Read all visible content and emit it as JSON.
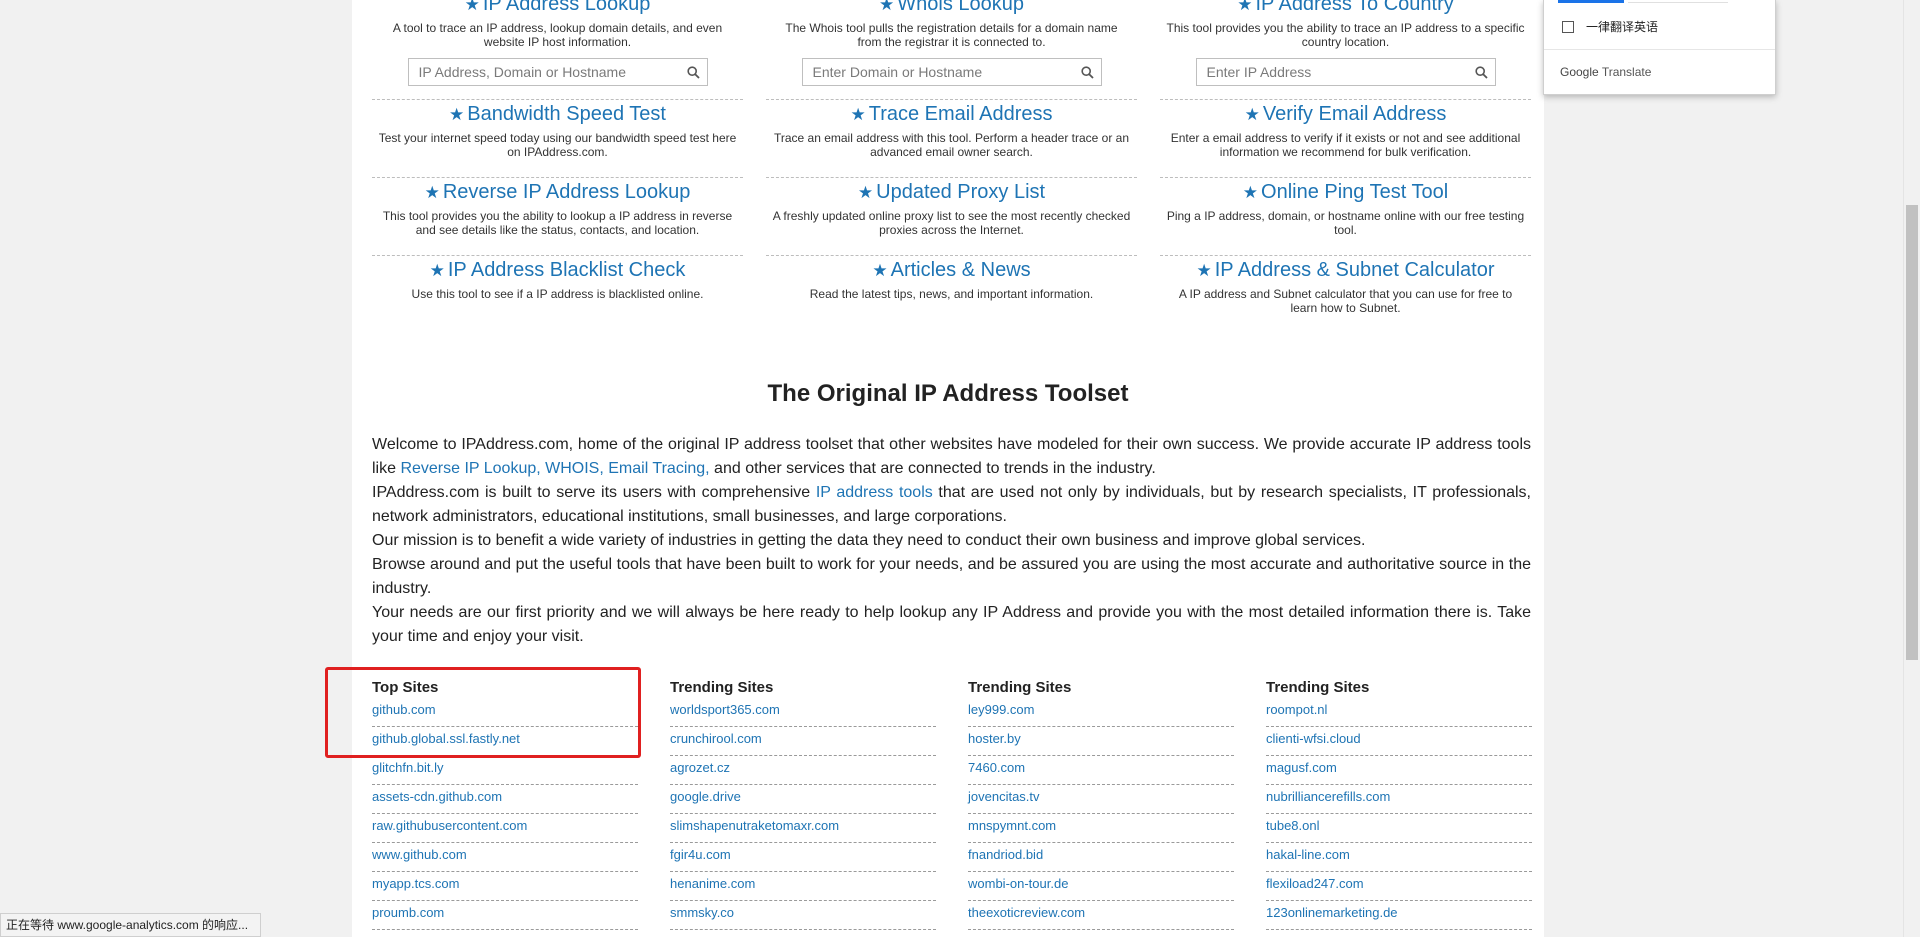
{
  "tools": [
    {
      "title": "IP Address Lookup",
      "desc": "A tool to trace an IP address, lookup domain details, and even website IP host information.",
      "placeholder": "IP Address, Domain or Hostname"
    },
    {
      "title": "Whois Lookup",
      "desc": "The Whois tool pulls the registration details for a domain name from the registrar it is connected to.",
      "placeholder": "Enter Domain or Hostname"
    },
    {
      "title": "IP Address To Country",
      "desc": "This tool provides you the ability to trace an IP address to a specific country location.",
      "placeholder": "Enter IP Address"
    },
    {
      "title": "Bandwidth Speed Test",
      "desc": "Test your internet speed today using our bandwidth speed test here on IPAddress.com."
    },
    {
      "title": "Trace Email Address",
      "desc": "Trace an email address with this tool. Perform a header trace or an advanced email owner search."
    },
    {
      "title": "Verify Email Address",
      "desc": "Enter a email address to verify if it exists or not and see additional information we recommend for bulk verification."
    },
    {
      "title": "Reverse IP Address Lookup",
      "desc": "This tool provides you the ability to lookup a IP address in reverse and see details like the status, contacts, and location."
    },
    {
      "title": "Updated Proxy List",
      "desc": "A freshly updated online proxy list to see the most recently checked proxies across the Internet."
    },
    {
      "title": "Online Ping Test Tool",
      "desc": "Ping a IP address, domain, or hostname online with our free testing tool."
    },
    {
      "title": "IP Address Blacklist Check",
      "desc": "Use this tool to see if a IP address is blacklisted online."
    },
    {
      "title": "Articles & News",
      "desc": "Read the latest tips, news, and important information."
    },
    {
      "title": "IP Address & Subnet Calculator",
      "desc": "A IP address and Subnet calculator that you can use for free to learn how to Subnet."
    }
  ],
  "section_title": "The Original IP Address Toolset",
  "intro": {
    "p1_a": "Welcome to IPAddress.com, home of the original IP address toolset that other websites have modeled for their own success. We provide accurate IP address tools like ",
    "p1_link": "Reverse IP Lookup, WHOIS, Email Tracing,",
    "p1_b": " and other services that are connected to trends in the industry.",
    "p2_a": "IPAddress.com is built to serve its users with comprehensive ",
    "p2_link": "IP address tools",
    "p2_b": " that are used not only by individuals, but by research specialists, IT professionals, network administrators, educational institutions, small businesses, and large corporations.",
    "p3": "Our mission is to benefit a wide variety of industries in getting the data they need to conduct their own business and improve global services.",
    "p4": "Browse around and put the useful tools that have been built to work for your needs, and be assured you are using the most accurate and authoritative source in the industry.",
    "p5": "Your needs are our first priority and we will always be here ready to help lookup any IP Address and provide you with the most detailed information there is. Take your time and enjoy your visit."
  },
  "site_columns": [
    {
      "title": "Top Sites",
      "items": [
        "github.com",
        "github.global.ssl.fastly.net",
        "glitchfn.bit.ly",
        "assets-cdn.github.com",
        "raw.githubusercontent.com",
        "www.github.com",
        "myapp.tcs.com",
        "proumb.com"
      ]
    },
    {
      "title": "Trending Sites",
      "items": [
        "worldsport365.com",
        "crunchirool.com",
        "agrozet.cz",
        "google.drive",
        "slimshapenutraketomaxr.com",
        "fgir4u.com",
        "henanime.com",
        "smmsky.co"
      ]
    },
    {
      "title": "Trending Sites",
      "items": [
        "ley999.com",
        "hoster.by",
        "7460.com",
        "jovencitas.tv",
        "mnspymnt.com",
        "fnandriod.bid",
        "wombi-on-tour.de",
        "theexoticreview.com"
      ]
    },
    {
      "title": "Trending Sites",
      "items": [
        "roompot.nl",
        "clienti-wfsi.cloud",
        "magusf.com",
        "nubrilliancerefills.com",
        "tube8.onl",
        "hakal-line.com",
        "flexiload247.com",
        "123onlinemarketing.de"
      ]
    }
  ],
  "translate": {
    "checkbox_label": "一律翻译英语",
    "brand_google": "Google",
    "brand_translate": "Translate"
  },
  "status_text": "正在等待 www.google-analytics.com 的响应...",
  "colors": {
    "link": "#1e74b4",
    "highlight": "#e02020"
  }
}
